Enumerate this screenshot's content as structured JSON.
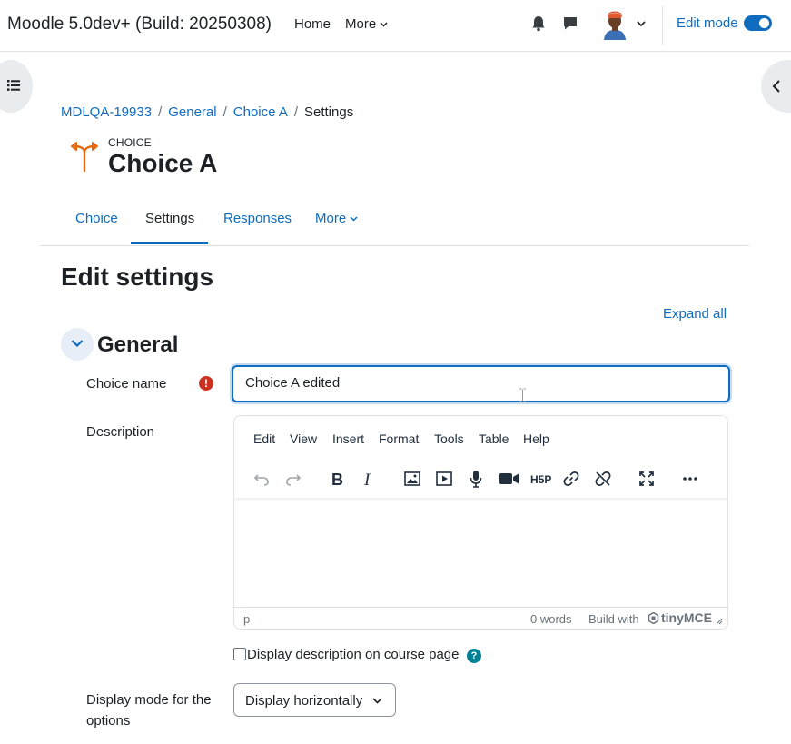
{
  "navbar": {
    "site_name": "Moodle 5.0dev+ (Build: 20250308)",
    "home_label": "Home",
    "more_label": "More",
    "edit_mode_label": "Edit mode",
    "edit_mode_on": true
  },
  "breadcrumb": {
    "items": [
      "MDLQA-19933",
      "General",
      "Choice A"
    ],
    "current": "Settings"
  },
  "header": {
    "module_type": "CHOICE",
    "title": "Choice A",
    "icon_color": "#e5670d"
  },
  "secondary_nav": {
    "tabs": [
      {
        "label": "Choice",
        "active": false
      },
      {
        "label": "Settings",
        "active": true
      },
      {
        "label": "Responses",
        "active": false
      },
      {
        "label": "More",
        "active": false
      }
    ]
  },
  "page": {
    "heading": "Edit settings",
    "expand_all_label": "Expand all"
  },
  "section": {
    "title": "General",
    "expanded": true
  },
  "form": {
    "choice_name_label": "Choice name",
    "choice_name_value": "Choice A edited",
    "description_label": "Description",
    "editor": {
      "menus": [
        "Edit",
        "View",
        "Insert",
        "Format",
        "Tools",
        "Table",
        "Help"
      ],
      "toolbar_icons": [
        "undo-icon",
        "redo-icon",
        "bold-icon",
        "italic-icon",
        "image-icon",
        "media-icon",
        "microphone-icon",
        "video-icon",
        "h5p-icon",
        "link-icon",
        "unlink-icon",
        "fullscreen-icon",
        "more-icon"
      ],
      "status_path": "p",
      "word_count": "0 words",
      "build_with": "Build with",
      "brand": "tinyMCE"
    },
    "display_description_label": "Display description on course page",
    "display_description_checked": false,
    "display_mode_label": "Display mode for the options",
    "display_mode_value": "Display horizontally"
  },
  "colors": {
    "primary": "#0f6cbf",
    "required": "#ca3120",
    "help": "#008196"
  }
}
